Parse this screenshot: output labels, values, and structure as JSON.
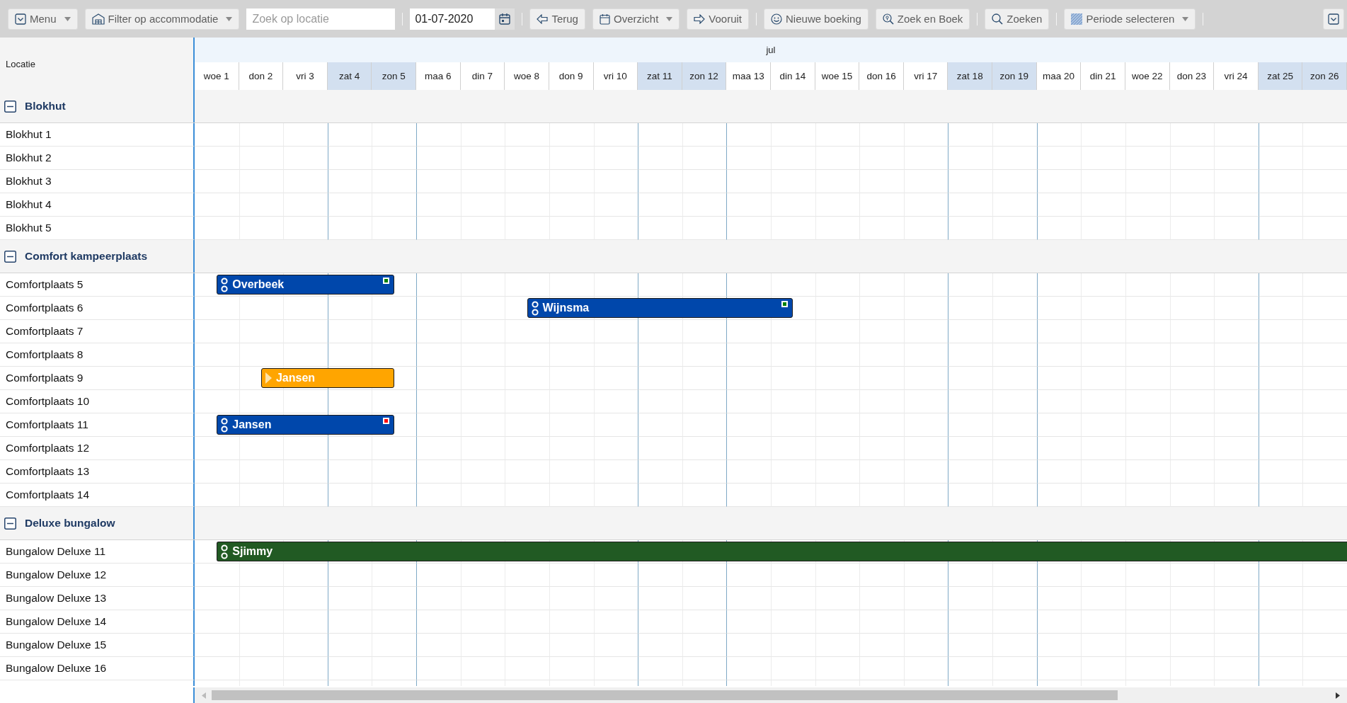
{
  "toolbar": {
    "menu": {
      "label": "Menu",
      "dropdown": true
    },
    "filter": {
      "label": "Filter op accommodatie",
      "dropdown": true
    },
    "location_search": {
      "placeholder": "Zoek op locatie"
    },
    "date": {
      "value": "01-07-2020"
    },
    "back": {
      "label": "Terug"
    },
    "overview": {
      "label": "Overzicht",
      "dropdown": true
    },
    "forward": {
      "label": "Vooruit"
    },
    "new_booking": {
      "label": "Nieuwe boeking"
    },
    "search_and_book": {
      "label": "Zoek en Boek"
    },
    "search": {
      "label": "Zoeken"
    },
    "period": {
      "label": "Periode selecteren",
      "dropdown": true
    }
  },
  "planner": {
    "location_header": "Locatie",
    "month": "jul",
    "days": [
      {
        "label": "woe 1",
        "weekend": false
      },
      {
        "label": "don 2",
        "weekend": false
      },
      {
        "label": "vri 3",
        "weekend": false
      },
      {
        "label": "zat 4",
        "weekend": true
      },
      {
        "label": "zon 5",
        "weekend": true
      },
      {
        "label": "maa 6",
        "weekend": false
      },
      {
        "label": "din 7",
        "weekend": false
      },
      {
        "label": "woe 8",
        "weekend": false
      },
      {
        "label": "don 9",
        "weekend": false
      },
      {
        "label": "vri 10",
        "weekend": false
      },
      {
        "label": "zat 11",
        "weekend": true
      },
      {
        "label": "zon 12",
        "weekend": true
      },
      {
        "label": "maa 13",
        "weekend": false
      },
      {
        "label": "din 14",
        "weekend": false
      },
      {
        "label": "woe 15",
        "weekend": false
      },
      {
        "label": "don 16",
        "weekend": false
      },
      {
        "label": "vri 17",
        "weekend": false
      },
      {
        "label": "zat 18",
        "weekend": true
      },
      {
        "label": "zon 19",
        "weekend": true
      },
      {
        "label": "maa 20",
        "weekend": false
      },
      {
        "label": "din 21",
        "weekend": false
      },
      {
        "label": "woe 22",
        "weekend": false
      },
      {
        "label": "don 23",
        "weekend": false
      },
      {
        "label": "vri 24",
        "weekend": false
      },
      {
        "label": "zat 25",
        "weekend": true
      },
      {
        "label": "zon 26",
        "weekend": true
      }
    ],
    "groups": [
      {
        "name": "Blokhut",
        "expanded": true,
        "rows": [
          {
            "name": "Blokhut 1"
          },
          {
            "name": "Blokhut 2"
          },
          {
            "name": "Blokhut 3"
          },
          {
            "name": "Blokhut 4"
          },
          {
            "name": "Blokhut 5"
          }
        ]
      },
      {
        "name": "Comfort kampeerplaats",
        "expanded": true,
        "rows": [
          {
            "name": "Comfortplaats 5",
            "booking": {
              "name": "Overbeek",
              "kind": "booked",
              "color": "#0047ab",
              "flag": {
                "color": "#008000"
              },
              "nights": [
                true,
                true,
                true,
                true,
                false,
                false,
                false,
                false,
                false,
                false,
                false,
                false,
                false,
                false,
                false,
                false,
                false,
                false,
                false,
                false,
                false,
                false,
                false,
                false,
                false,
                false
              ]
            }
          },
          {
            "name": "Comfortplaats 6",
            "booking": {
              "name": "Wijnsma",
              "kind": "booked",
              "color": "#0047ab",
              "flag": {
                "color": "#008000"
              },
              "nights": [
                false,
                false,
                false,
                false,
                false,
                false,
                false,
                true,
                true,
                true,
                true,
                true,
                true,
                false,
                false,
                false,
                false,
                false,
                false,
                false,
                false,
                false,
                false,
                false,
                false,
                false
              ]
            }
          },
          {
            "name": "Comfortplaats 7"
          },
          {
            "name": "Comfortplaats 8"
          },
          {
            "name": "Comfortplaats 9",
            "booking": {
              "name": "Jansen",
              "kind": "pending",
              "color": "#ffa500",
              "nights": [
                false,
                true,
                true,
                true,
                false,
                false,
                false,
                false,
                false,
                false,
                false,
                false,
                false,
                false,
                false,
                false,
                false,
                false,
                false,
                false,
                false,
                false,
                false,
                false,
                false,
                false
              ]
            }
          },
          {
            "name": "Comfortplaats 10"
          },
          {
            "name": "Comfortplaats 11",
            "booking": {
              "name": "Jansen",
              "kind": "booked",
              "color": "#0047ab",
              "flag": {
                "color": "#ff0000"
              },
              "nights": [
                true,
                true,
                true,
                true,
                false,
                false,
                false,
                false,
                false,
                false,
                false,
                false,
                false,
                false,
                false,
                false,
                false,
                false,
                false,
                false,
                false,
                false,
                false,
                false,
                false,
                false
              ]
            }
          },
          {
            "name": "Comfortplaats 12"
          },
          {
            "name": "Comfortplaats 13"
          },
          {
            "name": "Comfortplaats 14"
          }
        ]
      },
      {
        "name": "Deluxe bungalow",
        "expanded": true,
        "rows": [
          {
            "name": "Bungalow Deluxe 11",
            "booking": {
              "name": "Sjimmy",
              "kind": "booked",
              "color": "#215a23",
              "nights": [
                true,
                true,
                true,
                true,
                true,
                true,
                true,
                true,
                true,
                true,
                true,
                true,
                true,
                true,
                true,
                true,
                true,
                true,
                true,
                true,
                true,
                true,
                true,
                true,
                true,
                true
              ]
            }
          },
          {
            "name": "Bungalow Deluxe 12"
          },
          {
            "name": "Bungalow Deluxe 13"
          },
          {
            "name": "Bungalow Deluxe 14"
          },
          {
            "name": "Bungalow Deluxe 15"
          },
          {
            "name": "Bungalow Deluxe 16"
          }
        ]
      }
    ]
  }
}
